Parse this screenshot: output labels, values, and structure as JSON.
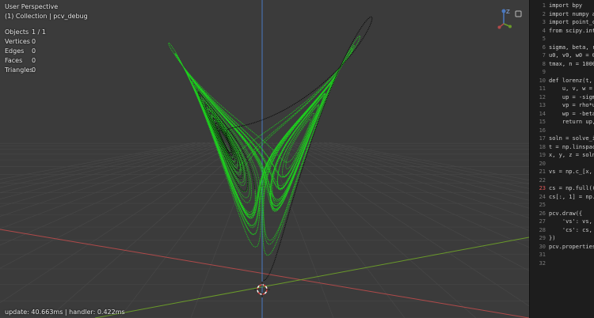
{
  "viewport": {
    "perspective": "User Perspective",
    "collection": "(1) Collection | pcv_debug",
    "stats": [
      {
        "label": "Objects",
        "value": "1 / 1"
      },
      {
        "label": "Vertices",
        "value": "0"
      },
      {
        "label": "Edges",
        "value": "0"
      },
      {
        "label": "Faces",
        "value": "0"
      },
      {
        "label": "Triangles",
        "value": "0"
      }
    ],
    "footer": "update: 40.663ms | handler: 0.422ms",
    "gizmo_axis_label": "Z",
    "colors": {
      "trajectory_green": "#19e019",
      "trajectory_black": "#0a0a0a",
      "grid": "#474747",
      "axis_x": "#b04a4a",
      "axis_y": "#6a9a2a",
      "z_axis": "#4a78c0"
    }
  },
  "editor": {
    "lines": [
      {
        "n": "1",
        "text": "import bpy"
      },
      {
        "n": "2",
        "text": "import numpy a"
      },
      {
        "n": "3",
        "text": "import point_c"
      },
      {
        "n": "4",
        "text": "from scipy.int"
      },
      {
        "n": "5",
        "text": ""
      },
      {
        "n": "6",
        "text": "sigma, beta, r"
      },
      {
        "n": "7",
        "text": "u0, v0, w0 = 0"
      },
      {
        "n": "8",
        "text": "tmax, n = 1000"
      },
      {
        "n": "9",
        "text": ""
      },
      {
        "n": "10",
        "text": "def lorenz(t,"
      },
      {
        "n": "11",
        "text": "    u, v, w ="
      },
      {
        "n": "12",
        "text": "    up = -sigm"
      },
      {
        "n": "13",
        "text": "    vp = rho*u"
      },
      {
        "n": "14",
        "text": "    wp = -beta"
      },
      {
        "n": "15",
        "text": "    return up,"
      },
      {
        "n": "16",
        "text": ""
      },
      {
        "n": "17",
        "text": "soln = solve_i"
      },
      {
        "n": "18",
        "text": "t = np.linspac"
      },
      {
        "n": "19",
        "text": "x, y, z = soln"
      },
      {
        "n": "20",
        "text": ""
      },
      {
        "n": "21",
        "text": "vs = np.c_[x,"
      },
      {
        "n": "22",
        "text": ""
      },
      {
        "n": "23",
        "text": "cs = np.full(("
      },
      {
        "n": "24",
        "text": "cs[:, 1] = np."
      },
      {
        "n": "25",
        "text": ""
      },
      {
        "n": "26",
        "text": "pcv.draw({"
      },
      {
        "n": "27",
        "text": "    'vs': vs,"
      },
      {
        "n": "28",
        "text": "    'cs': cs,"
      },
      {
        "n": "29",
        "text": "})"
      },
      {
        "n": "30",
        "text": "pcv.properties"
      },
      {
        "n": "31",
        "text": ""
      },
      {
        "n": "32",
        "text": ""
      }
    ]
  }
}
